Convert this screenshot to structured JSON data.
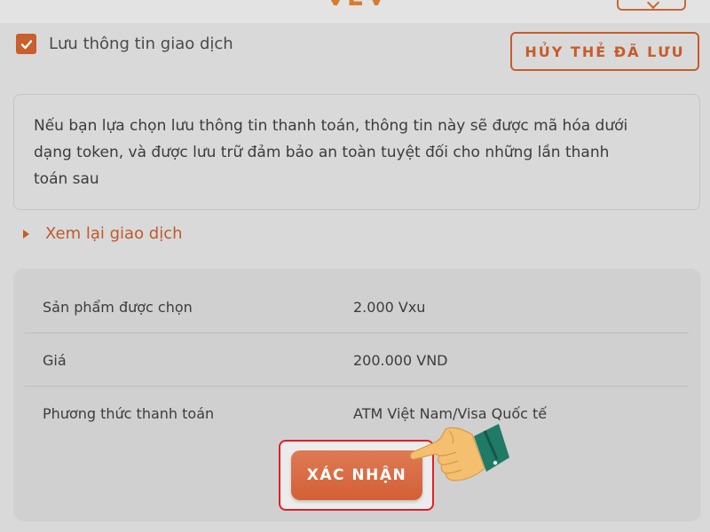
{
  "save_info": {
    "checked": true,
    "label": "Lưu thông tin giao dịch"
  },
  "cancel_saved_card_label": "HỦY THẺ ĐÃ LƯU",
  "info_note": {
    "line1": "Nếu bạn lựa chọn lưu thông tin thanh toán, thông tin này sẽ được mã hóa dưới",
    "line2": "dạng token, và được lưu trữ đảm bảo an toàn tuyệt đối cho những lần thanh",
    "line3": "toán sau"
  },
  "review_label": "Xem lại giao dịch",
  "summary": {
    "rows": [
      {
        "label": "Sản phẩm được chọn",
        "value": "2.000 Vxu"
      },
      {
        "label": "Giá",
        "value": "200.000 VND"
      },
      {
        "label": "Phương thức thanh toán",
        "value": "ATM Việt Nam/Visa Quốc tế"
      }
    ]
  },
  "confirm_label": "XÁC NHẬN",
  "icons": {
    "checkbox": "check-icon",
    "review": "caret-right-icon",
    "pointer": "pointing-hand-icon"
  },
  "colors": {
    "accent": "#c65c2a",
    "confirm": "#d9683e",
    "highlight": "#e31e24"
  }
}
